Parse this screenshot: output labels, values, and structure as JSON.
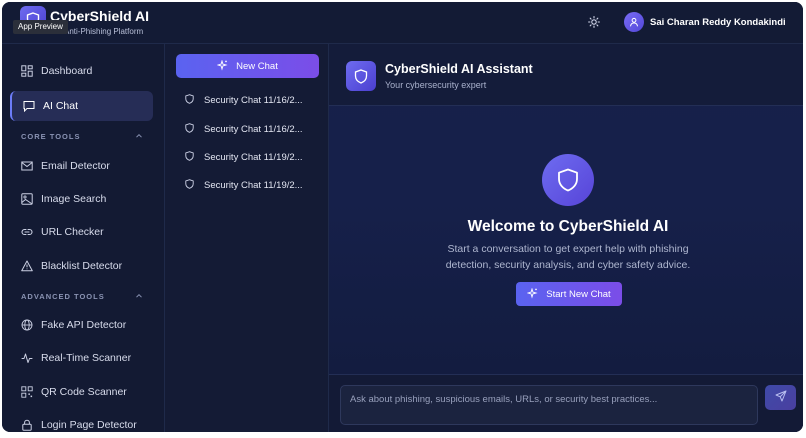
{
  "header": {
    "app_title": "CyberShield AI",
    "app_subtitle": "Anti-Phishing Platform",
    "preview_tag": "App Preview",
    "user_name": "Sai Charan Reddy Kondakindi"
  },
  "sidebar": {
    "items_top": [
      {
        "label": "Dashboard",
        "icon": "grid-icon"
      },
      {
        "label": "AI Chat",
        "icon": "chat-bubble-icon",
        "active": true
      }
    ],
    "core_tools": {
      "title": "CORE TOOLS",
      "items": [
        {
          "label": "Email Detector",
          "icon": "mail-icon"
        },
        {
          "label": "Image Search",
          "icon": "image-icon"
        },
        {
          "label": "URL Checker",
          "icon": "link-icon"
        },
        {
          "label": "Blacklist Detector",
          "icon": "warning-triangle-icon"
        }
      ]
    },
    "advanced_tools": {
      "title": "ADVANCED TOOLS",
      "items": [
        {
          "label": "Fake API Detector",
          "icon": "globe-icon"
        },
        {
          "label": "Real-Time Scanner",
          "icon": "pulse-icon"
        },
        {
          "label": "QR Code Scanner",
          "icon": "qr-code-icon"
        },
        {
          "label": "Login Page Detector",
          "icon": "lock-icon"
        }
      ]
    }
  },
  "chatlist": {
    "new_chat_label": "New Chat",
    "chats": [
      "Security Chat 11/16/2...",
      "Security Chat 11/16/2...",
      "Security Chat 11/19/2...",
      "Security Chat 11/19/2..."
    ]
  },
  "main": {
    "assistant_title": "CyberShield AI Assistant",
    "assistant_subtitle": "Your cybersecurity expert",
    "welcome_title": "Welcome to CyberShield AI",
    "welcome_text": "Start a conversation to get expert help with phishing detection, security analysis, and cyber safety advice.",
    "start_button_label": "Start New Chat",
    "input_placeholder": "Ask about phishing, suspicious emails, URLs, or security best practices..."
  },
  "colors": {
    "background": "#121a33",
    "accent_start": "#5a63f0",
    "accent_end": "#7b4de8",
    "active_nav": "#262d56"
  }
}
